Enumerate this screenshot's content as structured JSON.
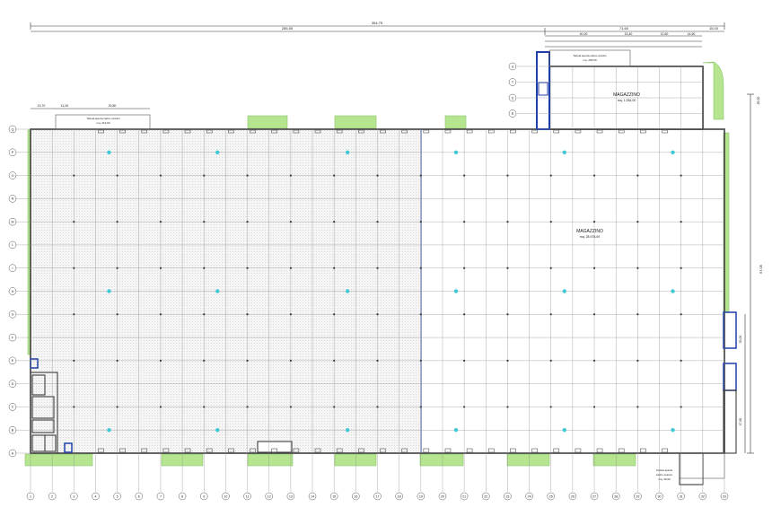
{
  "dimensions": {
    "overall": "354,75",
    "main": "285,55",
    "annex": "71,60",
    "annex_right": "15,00",
    "height_total": "97,05",
    "height_side": "72,05",
    "height_annex": "25,00",
    "left_a": "13,70",
    "left_b": "11,00",
    "left_c": "29,80",
    "annex_sub": [
      "40,00",
      "15,40",
      "12,60",
      "14,60"
    ],
    "right_a": "33,00",
    "right_b": "47,60"
  },
  "rooms": {
    "main": {
      "name": "MAGAZZINO",
      "area": "mq. 28.978,09"
    },
    "annex": {
      "name": "MAGAZZINO",
      "area": "mq. 1.284,00"
    },
    "top_left_canopy": {
      "line1": "Tettoia aperta carico scarico",
      "line2": "mq. 213,90"
    },
    "top_right_canopy": {
      "line1": "Tettoia aperta carico scarico",
      "line2": "mq. 206,00"
    },
    "bottom_right_canopy": {
      "line1": "Tettoia aperta",
      "line2": "carico scarico",
      "line3": "mq. 46,00"
    }
  },
  "grid": {
    "columns": [
      "1",
      "2",
      "3",
      "4",
      "5",
      "6",
      "7",
      "8",
      "9",
      "10",
      "11",
      "12",
      "13",
      "14",
      "15",
      "16",
      "17",
      "18",
      "19",
      "20",
      "21",
      "22",
      "23",
      "24",
      "25",
      "26",
      "27",
      "28",
      "29",
      "30",
      "31",
      "32",
      "33"
    ],
    "rows": [
      "A",
      "B",
      "C",
      "D",
      "E",
      "F",
      "G",
      "H",
      "I",
      "L",
      "M",
      "N",
      "O",
      "P",
      "Q"
    ],
    "annex_rows": [
      "R",
      "S",
      "T",
      "U"
    ]
  },
  "colors": {
    "line": "#2b2b2b",
    "grid": "#8a8a8a",
    "green": "#b6e58f",
    "cyan": "#3ec9d6",
    "blue": "#1f3fa8",
    "hatch": "#f1f1f1"
  }
}
